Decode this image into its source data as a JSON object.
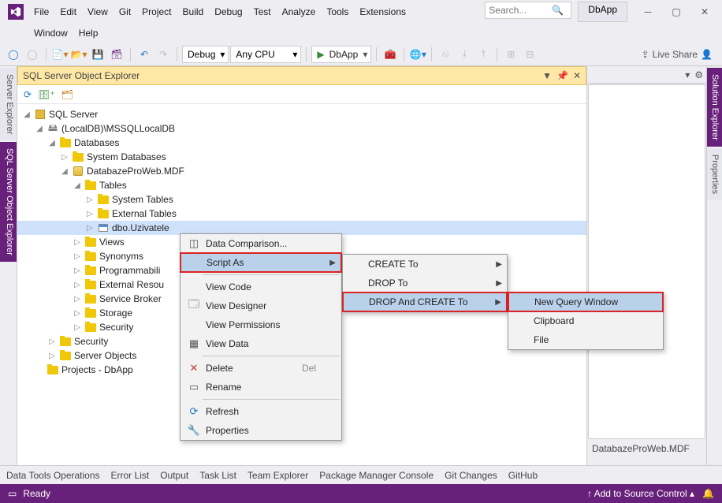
{
  "title_app": "DbApp",
  "search_placeholder": "Search...",
  "menu": [
    "File",
    "Edit",
    "View",
    "Git",
    "Project",
    "Build",
    "Debug",
    "Test",
    "Analyze",
    "Tools",
    "Extensions"
  ],
  "menu2": [
    "Window",
    "Help"
  ],
  "toolbar": {
    "config": "Debug",
    "platform": "Any CPU",
    "run": "DbApp",
    "live_share": "Live Share"
  },
  "side_left": [
    "Server Explorer",
    "SQL Server Object Explorer"
  ],
  "side_right": [
    "Solution Explorer",
    "Properties"
  ],
  "panel_title": "SQL Server Object Explorer",
  "right_label": "DatabazeProWeb.MDF",
  "tree": {
    "root": "SQL Server",
    "instance": "(LocalDB)\\MSSQLLocalDB",
    "databases": "Databases",
    "sys_db": "System Databases",
    "db": "DatabazeProWeb.MDF",
    "tables": "Tables",
    "sys_tables": "System Tables",
    "ext_tables": "External Tables",
    "table": "dbo.Uzivatele",
    "views": "Views",
    "synonyms": "Synonyms",
    "prog": "Programmabili",
    "extres": "External Resou",
    "sb": "Service Broker",
    "storage": "Storage",
    "sec": "Security",
    "sec2": "Security",
    "srvobj": "Server Objects",
    "projects": "Projects - DbApp"
  },
  "ctx1": {
    "data_comparison": "Data Comparison...",
    "script_as": "Script As",
    "view_code": "View Code",
    "view_designer": "View Designer",
    "view_perms": "View Permissions",
    "view_data": "View Data",
    "delete": "Delete",
    "delete_sh": "Del",
    "rename": "Rename",
    "refresh": "Refresh",
    "properties": "Properties"
  },
  "ctx2": {
    "create": "CREATE To",
    "drop": "DROP To",
    "dropcreate": "DROP And CREATE To"
  },
  "ctx3": {
    "new_query": "New Query Window",
    "clipboard": "Clipboard",
    "file": "File"
  },
  "bottom_tabs": [
    "Data Tools Operations",
    "Error List",
    "Output",
    "Task List",
    "Team Explorer",
    "Package Manager Console",
    "Git Changes",
    "GitHub"
  ],
  "status": {
    "ready": "Ready",
    "source_control": "Add to Source Control"
  }
}
